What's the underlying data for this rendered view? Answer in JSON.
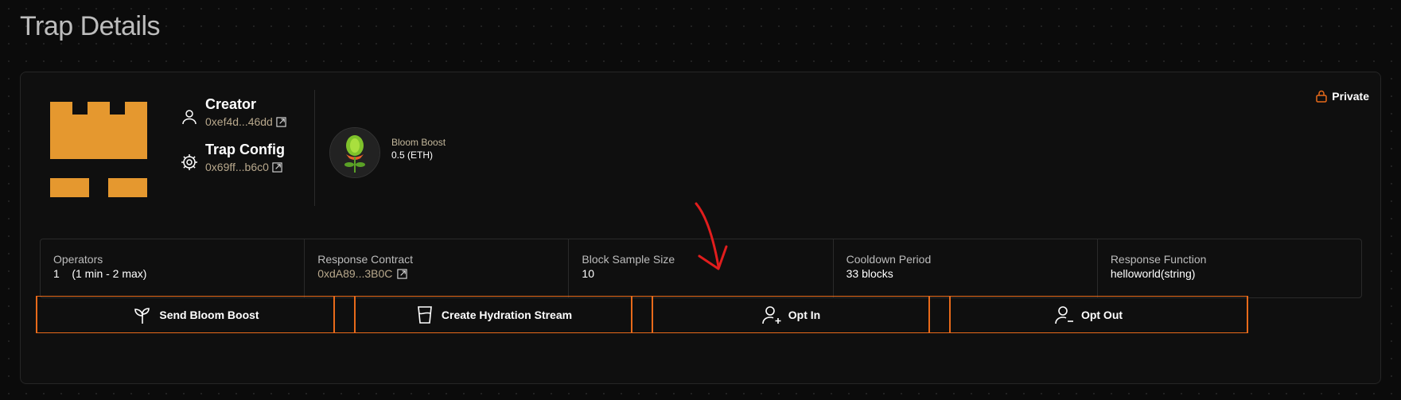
{
  "page": {
    "title": "Trap Details"
  },
  "creator": {
    "title": "Creator",
    "address": "0xef4d...46dd"
  },
  "trap_config": {
    "title": "Trap Config",
    "address": "0x69ff...b6c0"
  },
  "bloom_boost": {
    "label": "Bloom Boost",
    "value": "0.5 (ETH)"
  },
  "visibility": {
    "label": "Private"
  },
  "stats": [
    {
      "label": "Operators",
      "value": "1    (1 min - 2 max)"
    },
    {
      "label": "Response Contract",
      "value": "0xdA89...3B0C"
    },
    {
      "label": "Block Sample Size",
      "value": "10"
    },
    {
      "label": "Cooldown Period",
      "value": "33 blocks"
    },
    {
      "label": "Response Function",
      "value": "helloworld(string)"
    }
  ],
  "actions": [
    {
      "label": "Send Bloom Boost",
      "icon": "sprout-icon"
    },
    {
      "label": "Create Hydration Stream",
      "icon": "cup-icon"
    },
    {
      "label": "Opt In",
      "icon": "user-plus-icon"
    },
    {
      "label": "Opt Out",
      "icon": "user-minus-icon"
    }
  ],
  "colors": {
    "accent": "#e86a1a",
    "logo": "#e5982f",
    "address": "#b8a88c",
    "annotation": "#e11d1d"
  }
}
